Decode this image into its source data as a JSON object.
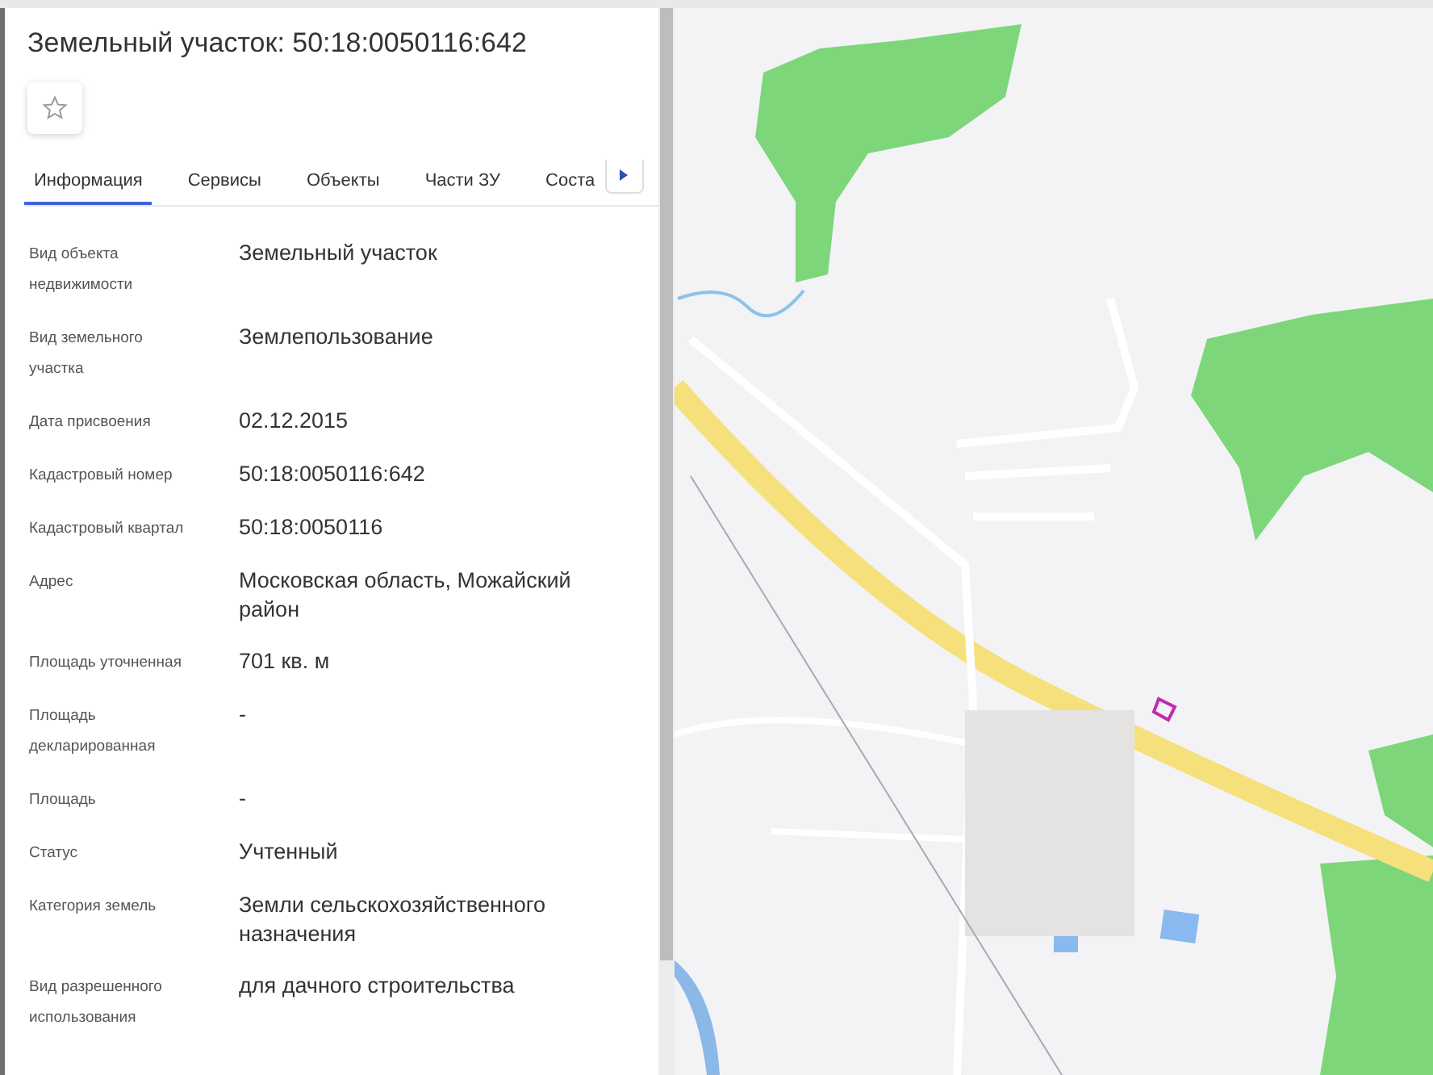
{
  "panel": {
    "title": "Земельный участок: 50:18:0050116:642",
    "favorite": {
      "checked": false
    },
    "tabs": [
      {
        "label": "Информация",
        "selected": true
      },
      {
        "label": "Сервисы",
        "selected": false
      },
      {
        "label": "Объекты",
        "selected": false
      },
      {
        "label": "Части ЗУ",
        "selected": false
      },
      {
        "label": "Соста",
        "selected": false
      }
    ],
    "fields": [
      {
        "label": "Вид объекта недвижимости",
        "value": "Земельный участок"
      },
      {
        "label": "Вид земельного участка",
        "value": "Землепользование"
      },
      {
        "label": "Дата присвоения",
        "value": "02.12.2015"
      },
      {
        "label": "Кадастровый номер",
        "value": "50:18:0050116:642"
      },
      {
        "label": "Кадастровый квартал",
        "value": "50:18:0050116"
      },
      {
        "label": "Адрес",
        "value": "Московская область, Можайский район"
      },
      {
        "label": "Площадь уточненная",
        "value": "701 кв. м"
      },
      {
        "label": "Площадь декларированная",
        "value": "-"
      },
      {
        "label": "Площадь",
        "value": "-"
      },
      {
        "label": "Статус",
        "value": "Учтенный"
      },
      {
        "label": "Категория земель",
        "value": "Земли сельскохозяйственного назначения"
      },
      {
        "label": "Вид разрешенного использования",
        "value": "для дачного строительства"
      }
    ]
  }
}
